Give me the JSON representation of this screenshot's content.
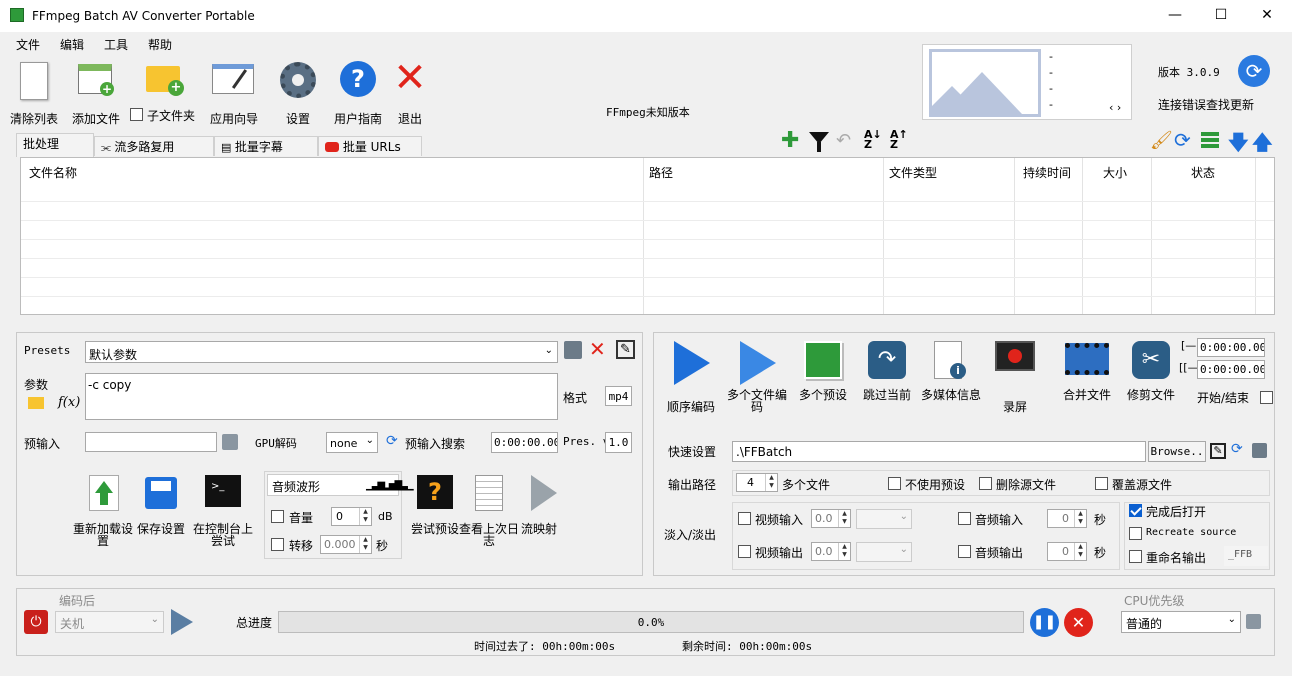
{
  "window": {
    "title": "FFmpeg Batch AV Converter Portable",
    "minimize": "—",
    "maximize": "☐",
    "close": "✕"
  },
  "menu": [
    "文件",
    "编辑",
    "工具",
    "帮助"
  ],
  "toolbar": {
    "clear_list": "清除列表",
    "add_files": "添加文件",
    "subfolders": "子文件夹",
    "app_wizard": "应用向导",
    "settings": "设置",
    "user_guide": "用户指南",
    "exit": "退出",
    "ffmpeg_version": "FFmpeg未知版本"
  },
  "preview": {
    "nav": "‹ ›"
  },
  "version": {
    "label": "版本 3.0.9",
    "update_link": "连接错误查找更新"
  },
  "tabs": [
    "批处理",
    "流多路复用",
    "批量字幕",
    "批量 URLs"
  ],
  "table": {
    "columns": [
      "文件名称",
      "路径",
      "文件类型",
      "持续时间",
      "大小",
      "状态"
    ]
  },
  "presets": {
    "label": "Presets",
    "value": "默认参数",
    "params_label": "参数",
    "params_value": "-c copy",
    "format_label": "格式",
    "format_value": "mp4",
    "preinput_label": "预输入",
    "gpu_label": "GPU解码",
    "gpu_value": "none",
    "preinput_search": "预输入搜索",
    "time_value": "0:00:00.000",
    "pres_label": "Pres. v",
    "pres_value": "1.0"
  },
  "left_buttons": {
    "reload": "重新加载设置",
    "save": "保存设置",
    "console": "在控制台上尝试",
    "audio_wave": "音频波形",
    "volume": "音量",
    "volume_value": "0",
    "db": "dB",
    "shift": "转移",
    "shift_value": "0.000",
    "sec": "秒",
    "try_preset": "尝试预设",
    "view_log": "查看上次日志",
    "stream_map": "流映射"
  },
  "right_buttons": {
    "sequential": "顺序编码",
    "multi_file": "多个文件编码",
    "multi_preset": "多个预设",
    "skip_current": "跳过当前",
    "media_info": "多媒体信息",
    "record": "录屏",
    "merge": "合并文件",
    "trim": "修剪文件",
    "start_end": "开始/结束",
    "start_icon": "[—",
    "end_icon": "[[—",
    "start_time": "0:00:00.000",
    "end_time": "0:00:00.000"
  },
  "output": {
    "quick_label": "快速设置",
    "quick_path": ".\\FFBatch",
    "browse": "Browse..",
    "out_label": "输出路径",
    "multi_count": "4",
    "multi_files": "多个文件",
    "no_preset": "不使用预设",
    "delete_src": "删除源文件",
    "overwrite": "覆盖源文件",
    "fade_label": "淡入/淡出",
    "video_in": "视频输入",
    "video_out": "视频输出",
    "fade_val": "0.0",
    "audio_in": "音频输入",
    "audio_out": "音频输出",
    "audio_val": "0",
    "sec": "秒",
    "open_done": "完成后打开",
    "recreate_src": "Recreate source",
    "rename_out": "重命名输出",
    "rename_suffix": "_FFB"
  },
  "footer": {
    "after_label": "编码后",
    "after_value": "关机",
    "progress_label": "总进度",
    "progress_text": "0.0%",
    "progress": 0.0,
    "elapsed": "时间过去了: 00h:00m:00s",
    "remaining": "剩余时间: 00h:00m:00s",
    "cpu_label": "CPU优先级",
    "cpu_value": "普通的"
  }
}
